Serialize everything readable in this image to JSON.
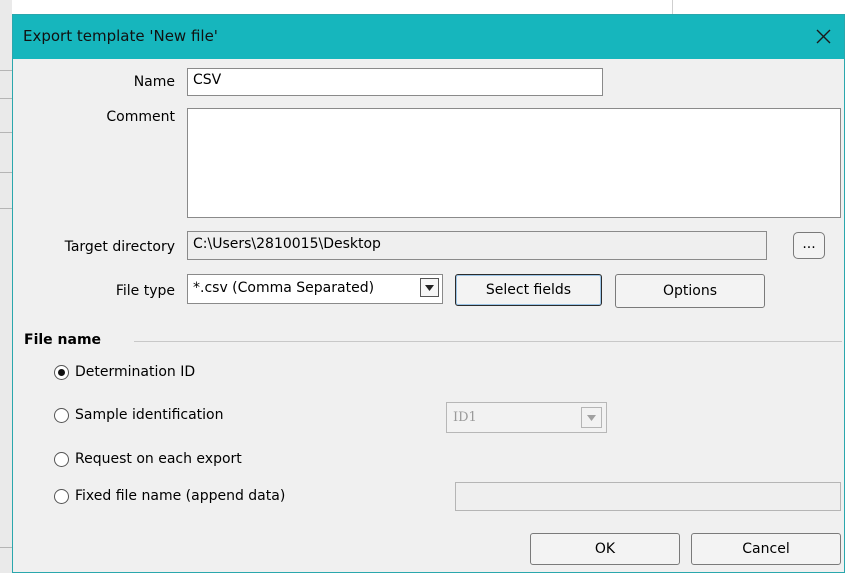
{
  "dialog": {
    "title": "Export template 'New file'"
  },
  "form": {
    "name_label": "Name",
    "name_value": "CSV",
    "comment_label": "Comment",
    "comment_value": "",
    "target_directory_label": "Target directory",
    "target_directory_value": "C:\\Users\\2810015\\Desktop",
    "browse_label": "...",
    "file_type_label": "File type",
    "file_type_value": "*.csv (Comma Separated)",
    "select_fields_label": "Select fields",
    "options_label": "Options"
  },
  "file_name": {
    "title": "File name",
    "selected": "Determination ID",
    "options": [
      "Determination ID",
      "Sample identification",
      "Request on each export",
      "Fixed file name (append data)"
    ],
    "sample_id_value": "ID1",
    "fixed_file_name_value": ""
  },
  "footer": {
    "ok_label": "OK",
    "cancel_label": "Cancel"
  },
  "colors": {
    "titlebar": "#16b6bd",
    "dialog_bg": "#f0f0f0"
  }
}
